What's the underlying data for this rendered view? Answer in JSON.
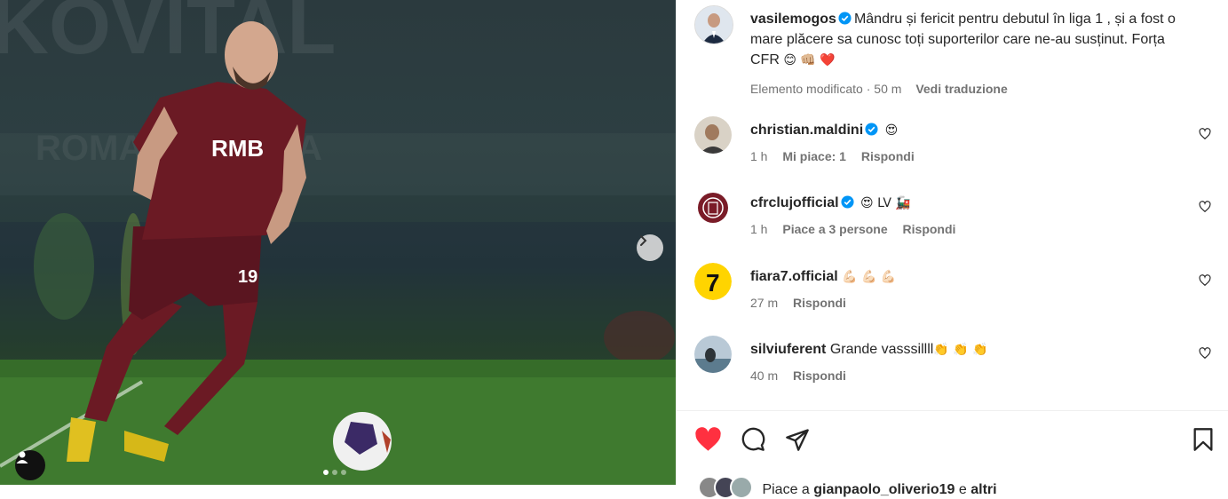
{
  "post": {
    "author": "vasilemogos",
    "caption": "Mândru și fericit pentru debutul în liga 1 , și a fost o mare plăcere sa cunosc toți suporterilor care ne-au susținut. Forța CFR",
    "caption_emojis": "😊 👊🏼 ❤️",
    "edited": "Elemento modificato",
    "separator": "·",
    "time": "50 m",
    "translate": "Vedi traduzione"
  },
  "jersey": {
    "sponsor": "RMB",
    "number": "19"
  },
  "comments": [
    {
      "user": "christian.maldini",
      "text": "😍",
      "time": "1 h",
      "likes": "Mi piace: 1",
      "reply": "Rispondi"
    },
    {
      "user": "cfrclujofficial",
      "text": "😍 LV 🚂",
      "time": "1 h",
      "likes": "Piace a 3 persone",
      "reply": "Rispondi"
    },
    {
      "user": "fiara7.official",
      "text": "💪🏻 💪🏻 💪🏻",
      "time": "27 m",
      "reply": "Rispondi"
    },
    {
      "user": "silviuferent",
      "text": "Grande vasssillll",
      "emojis": "👏 👏 👏",
      "time": "40 m",
      "reply": "Rispondi"
    }
  ],
  "likes_bar": {
    "prefix": "Piace a",
    "user": "gianpaolo_oliverio19",
    "middle": "e",
    "suffix": "altri"
  },
  "colors": {
    "liked": "#ff3040",
    "verified": "#0095f6",
    "shirt": "#6b1a24"
  },
  "icons": [
    "chevron-right-icon",
    "user-tag-icon",
    "heart-icon",
    "comment-icon",
    "share-icon",
    "bookmark-icon",
    "verified-icon"
  ]
}
